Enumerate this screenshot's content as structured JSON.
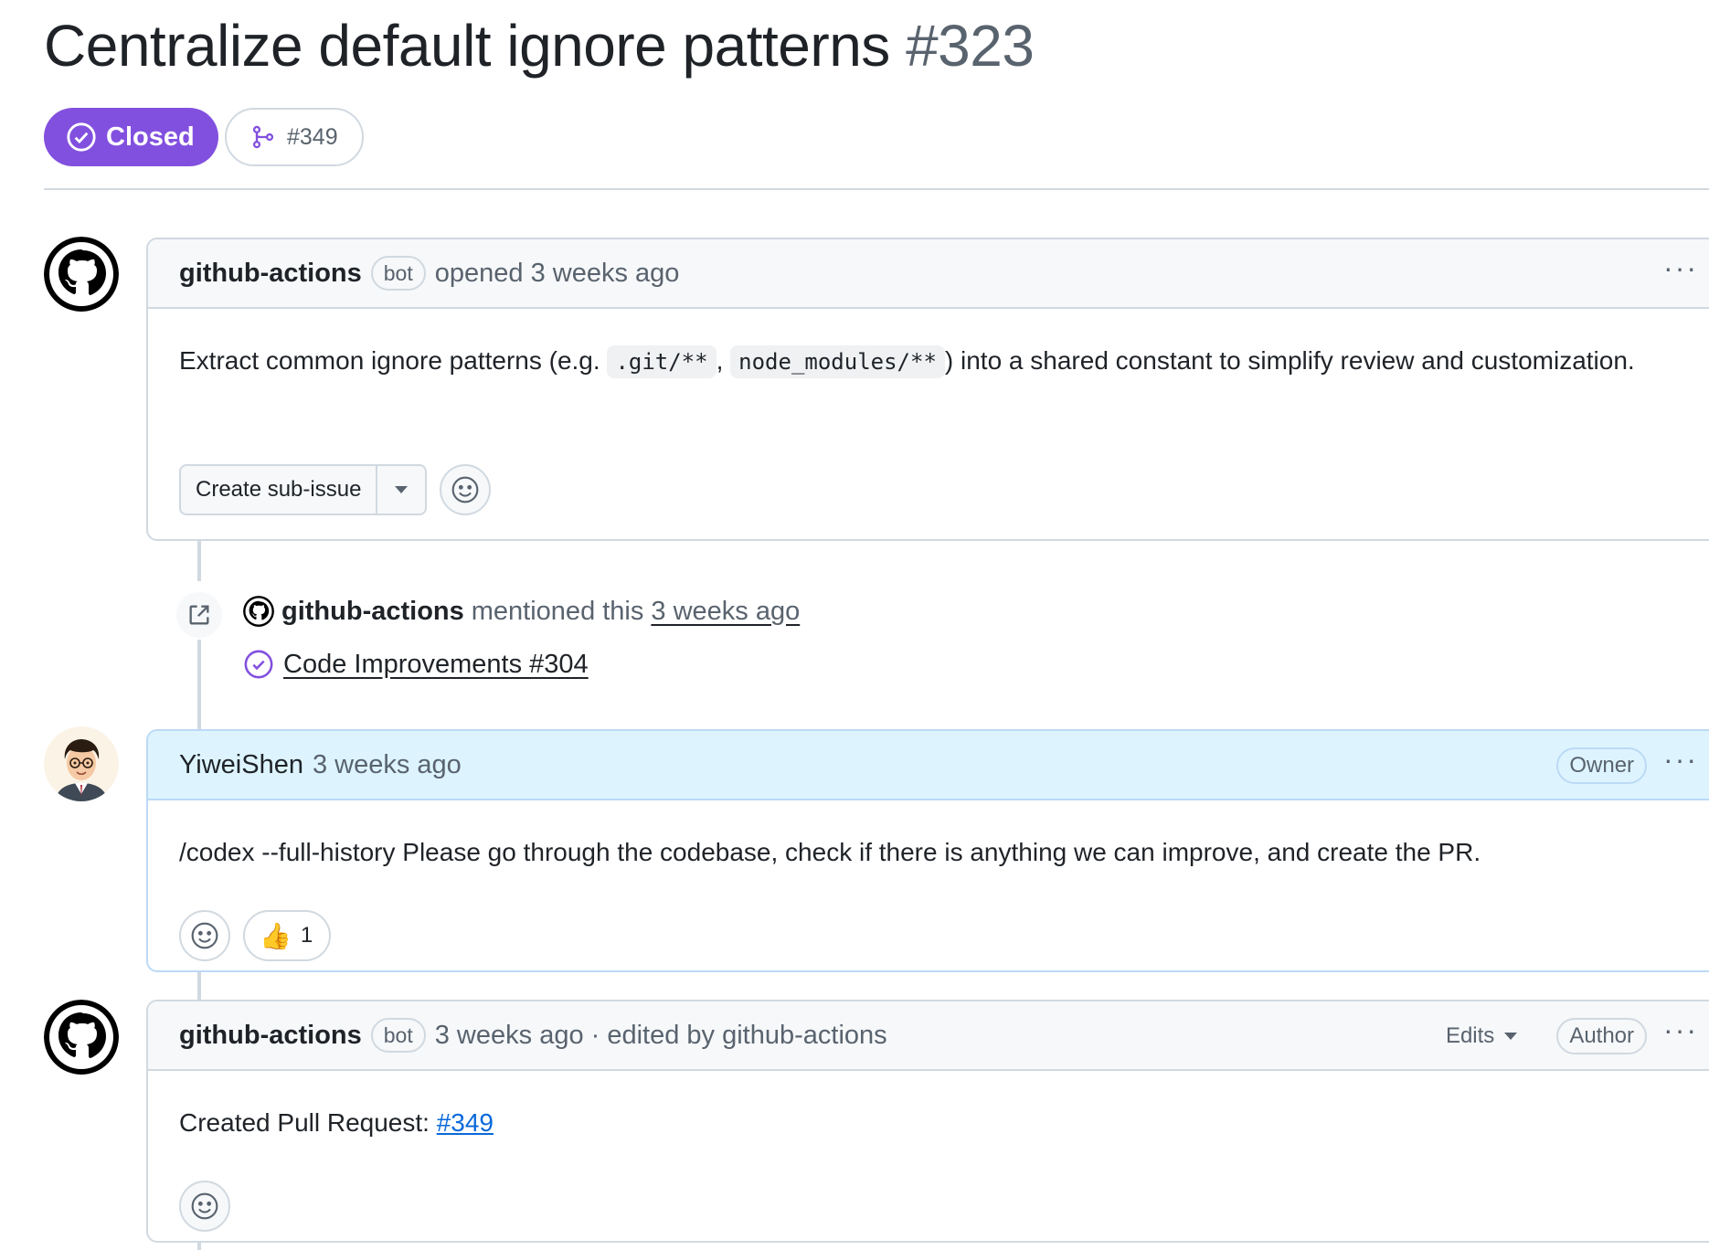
{
  "issue": {
    "title": "Centralize default ignore patterns",
    "number": "#323",
    "state": "Closed",
    "linked_pr": "#349"
  },
  "comments": [
    {
      "author": "github-actions",
      "tag": "bot",
      "meta": "opened 3 weeks ago",
      "body_pre": "Extract common ignore patterns (e.g.",
      "code1": ".git/**",
      "comma": ",",
      "code2": "node_modules/**",
      "body_post": ") into a shared constant to simplify review and customization.",
      "create_subissue_label": "Create sub-issue"
    },
    {
      "author": "YiweiShen",
      "meta": "3 weeks ago",
      "role": "Owner",
      "body": "/codex --full-history Please go through the codebase, check if there is anything we can improve, and create the PR.",
      "reaction_emoji": "👍",
      "reaction_count": "1"
    },
    {
      "author": "github-actions",
      "tag": "bot",
      "meta": "3 weeks ago · edited by github-actions",
      "edits_label": "Edits",
      "role": "Author",
      "body_pre": "Created Pull Request:",
      "pr_link": "#349"
    }
  ],
  "mention_event": {
    "actor": "github-actions",
    "action": "mentioned this",
    "time": "3 weeks ago",
    "ref_title": "Code Improvements #304"
  },
  "colors": {
    "closed_purple": "#8250df",
    "owner_header": "#ddf4ff",
    "link_blue": "#0969da"
  },
  "icons": [
    "closed-check-icon",
    "pull-request-icon",
    "github-octocat-icon",
    "smiley-icon",
    "cross-reference-icon",
    "thumbs-up-icon",
    "kebab-icon",
    "triangle-down-icon"
  ]
}
